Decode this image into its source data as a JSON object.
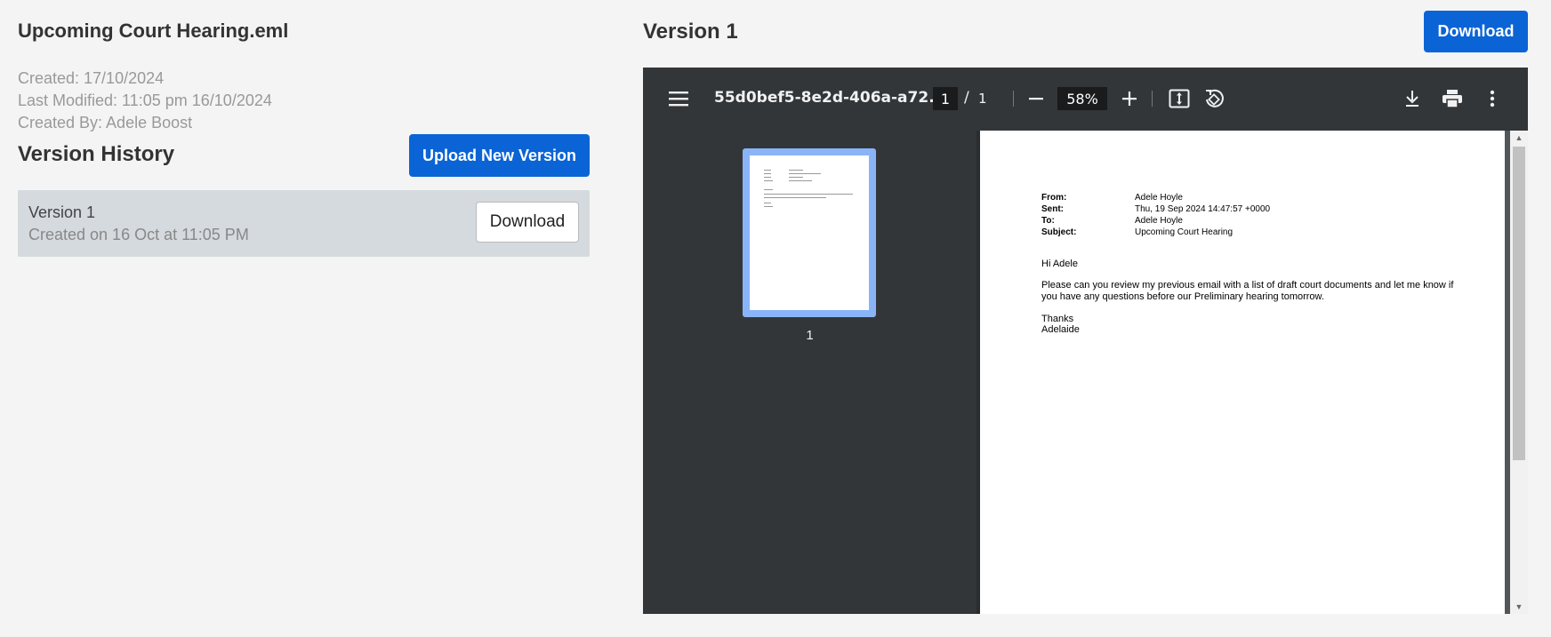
{
  "file": {
    "title": "Upcoming Court Hearing.eml",
    "created": "Created: 17/10/2024",
    "last_modified": "Last Modified: 11:05 pm 16/10/2024",
    "created_by": "Created By: Adele Boost"
  },
  "version_history": {
    "title": "Version History",
    "upload_label": "Upload New Version",
    "items": [
      {
        "name": "Version 1",
        "date": "Created on 16 Oct at 11:05 PM",
        "download_label": "Download"
      }
    ]
  },
  "preview": {
    "title": "Version 1",
    "download_label": "Download",
    "accent_color": "#0b64d6"
  },
  "viewer": {
    "doc_name": "55d0bef5-8e2d-406a-a72...",
    "page_current": "1",
    "page_separator": "/",
    "page_total": "1",
    "zoom": "58%",
    "thumbnail_page_number": "1",
    "icons": [
      "menu-icon",
      "zoom-out-icon",
      "zoom-in-icon",
      "fit-page-icon",
      "rotate-icon",
      "download-icon",
      "print-icon",
      "more-icon"
    ]
  },
  "email": {
    "from_label": "From:",
    "from_value": "Adele Hoyle",
    "sent_label": "Sent:",
    "sent_value": "Thu, 19 Sep 2024 14:47:57 +0000",
    "to_label": "To:",
    "to_value": "Adele Hoyle",
    "subject_label": "Subject:",
    "subject_value": "Upcoming Court Hearing",
    "greeting": "Hi Adele",
    "body_line1": "Please can you review my previous email with a list of draft court documents and let me know if",
    "body_line2": "you have any questions before our Preliminary hearing tomorrow.",
    "signoff": "Thanks",
    "signature": "Adelaide"
  }
}
